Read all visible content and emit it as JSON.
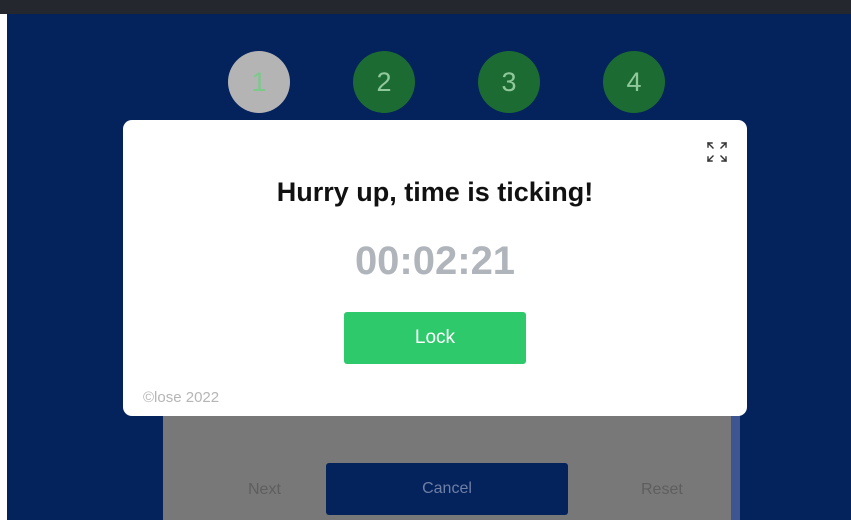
{
  "steps": [
    {
      "label": "1"
    },
    {
      "label": "2"
    },
    {
      "label": "3"
    },
    {
      "label": "4"
    }
  ],
  "panel": {
    "next_label": "Next",
    "cancel_label": "Cancel",
    "reset_label": "Reset"
  },
  "modal": {
    "title": "Hurry up, time is ticking!",
    "timer": "00:02:21",
    "lock_label": "Lock",
    "copyright": "©lose 2022",
    "expand_icon": "expand-icon"
  },
  "colors": {
    "app_background": "#04225c",
    "step_active": "#b4b4b4",
    "step_pending": "#1c6b32",
    "lock_button": "#2ec96a",
    "timer_text": "#b0b4bb"
  }
}
